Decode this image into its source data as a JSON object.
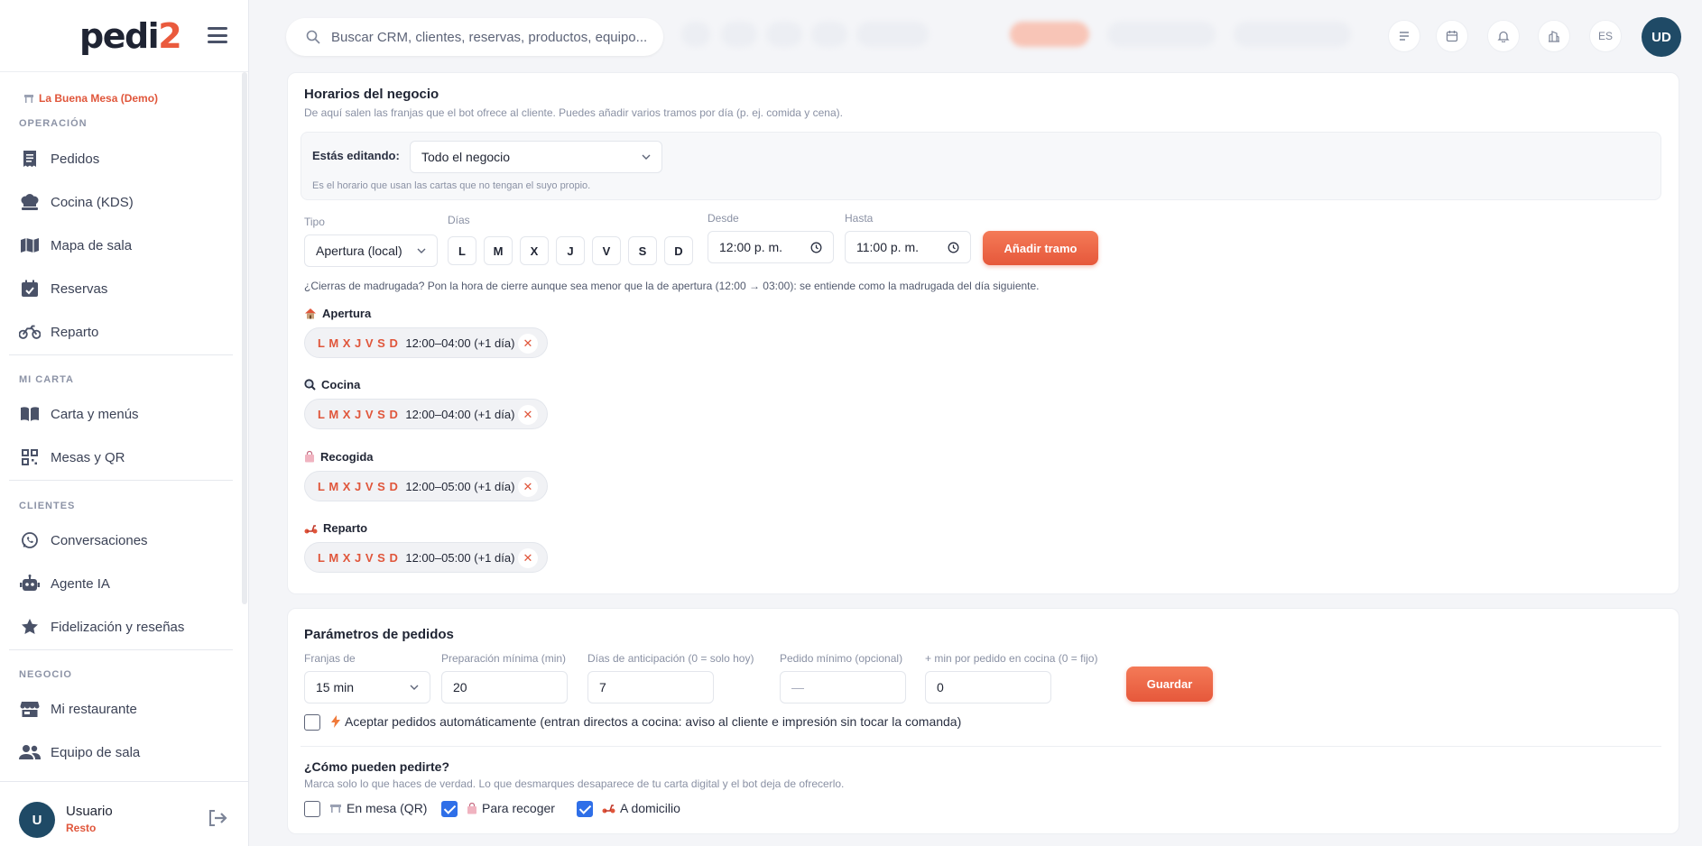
{
  "sidebar": {
    "org_name": "La Buena Mesa (Demo)",
    "sections": {
      "operacion": "OPERACIÓN",
      "mi_carta": "MI CARTA",
      "clientes": "CLIENTES",
      "negocio": "NEGOCIO"
    },
    "items": {
      "pedidos": "Pedidos",
      "cocina": "Cocina (KDS)",
      "mapa": "Mapa de sala",
      "reservas": "Reservas",
      "reparto": "Reparto",
      "carta": "Carta y menús",
      "mesas": "Mesas y QR",
      "conversaciones": "Conversaciones",
      "agente": "Agente IA",
      "fidelizacion": "Fidelización y reseñas",
      "restaurante": "Mi restaurante",
      "equipo": "Equipo de sala"
    },
    "user": {
      "initial": "U",
      "name": "Usuario",
      "role": "Resto"
    }
  },
  "logo": {
    "text": "pedi",
    "accent": "2"
  },
  "topbar": {
    "search_placeholder": "Buscar CRM, clientes, reservas, productos, equipo...",
    "lang": "ES",
    "avatar": "UD"
  },
  "horarios": {
    "title": "Horarios del negocio",
    "subtitle": "De aquí salen las franjas que el bot ofrece al cliente. Puedes añadir varios tramos por día (p. ej. comida y cena).",
    "editing_label": "Estás editando:",
    "editing_value": "Todo el negocio",
    "editing_note": "Es el horario que usan las cartas que no tengan el suyo propio.",
    "tipo_label": "Tipo",
    "tipo_value": "Apertura (local)",
    "dias_label": "Días",
    "days": [
      "L",
      "M",
      "X",
      "J",
      "V",
      "S",
      "D"
    ],
    "desde_label": "Desde",
    "desde_value": "12:00 p. m.",
    "hasta_label": "Hasta",
    "hasta_value": "11:00 p. m.",
    "add_button": "Añadir tramo",
    "hint": "¿Cierras de madrugada? Pon la hora de cierre aunque sea menor que la de apertura (12:00 → 03:00): se entiende como la madrugada del día siguiente.",
    "groups": [
      {
        "label": "Apertura",
        "days": "L M X J V S D",
        "range": "12:00–04:00 (+1 día)"
      },
      {
        "label": "Cocina",
        "days": "L M X J V S D",
        "range": "12:00–04:00 (+1 día)"
      },
      {
        "label": "Recogida",
        "days": "L M X J V S D",
        "range": "12:00–05:00 (+1 día)"
      },
      {
        "label": "Reparto",
        "days": "L M X J V S D",
        "range": "12:00–05:00 (+1 día)"
      }
    ]
  },
  "parametros": {
    "title": "Parámetros de pedidos",
    "franjas_label": "Franjas de",
    "franjas_value": "15 min",
    "prep_label": "Preparación mínima (min)",
    "prep_value": "20",
    "antic_label": "Días de anticipación (0 = solo hoy)",
    "antic_value": "7",
    "pedido_min_label": "Pedido mínimo (opcional)",
    "pedido_min_placeholder": "—",
    "min_cocina_label": "+ min por pedido en cocina (0 = fijo)",
    "min_cocina_value": "0",
    "save_button": "Guardar",
    "auto_accept": "Aceptar pedidos automáticamente (entran directos a cocina: aviso al cliente e impresión sin tocar la comanda)",
    "como_title": "¿Cómo pueden pedirte?",
    "como_sub": "Marca solo lo que haces de verdad. Lo que desmarques desaparece de tu carta digital y el bot deja de ofrecerlo.",
    "options": [
      {
        "label": "En mesa (QR)",
        "checked": false
      },
      {
        "label": "Para recoger",
        "checked": true
      },
      {
        "label": "A domicilio",
        "checked": true
      }
    ]
  },
  "colors": {
    "accent": "#e6583b",
    "navy": "#1f4a66",
    "checkbox": "#2f6fe8"
  }
}
